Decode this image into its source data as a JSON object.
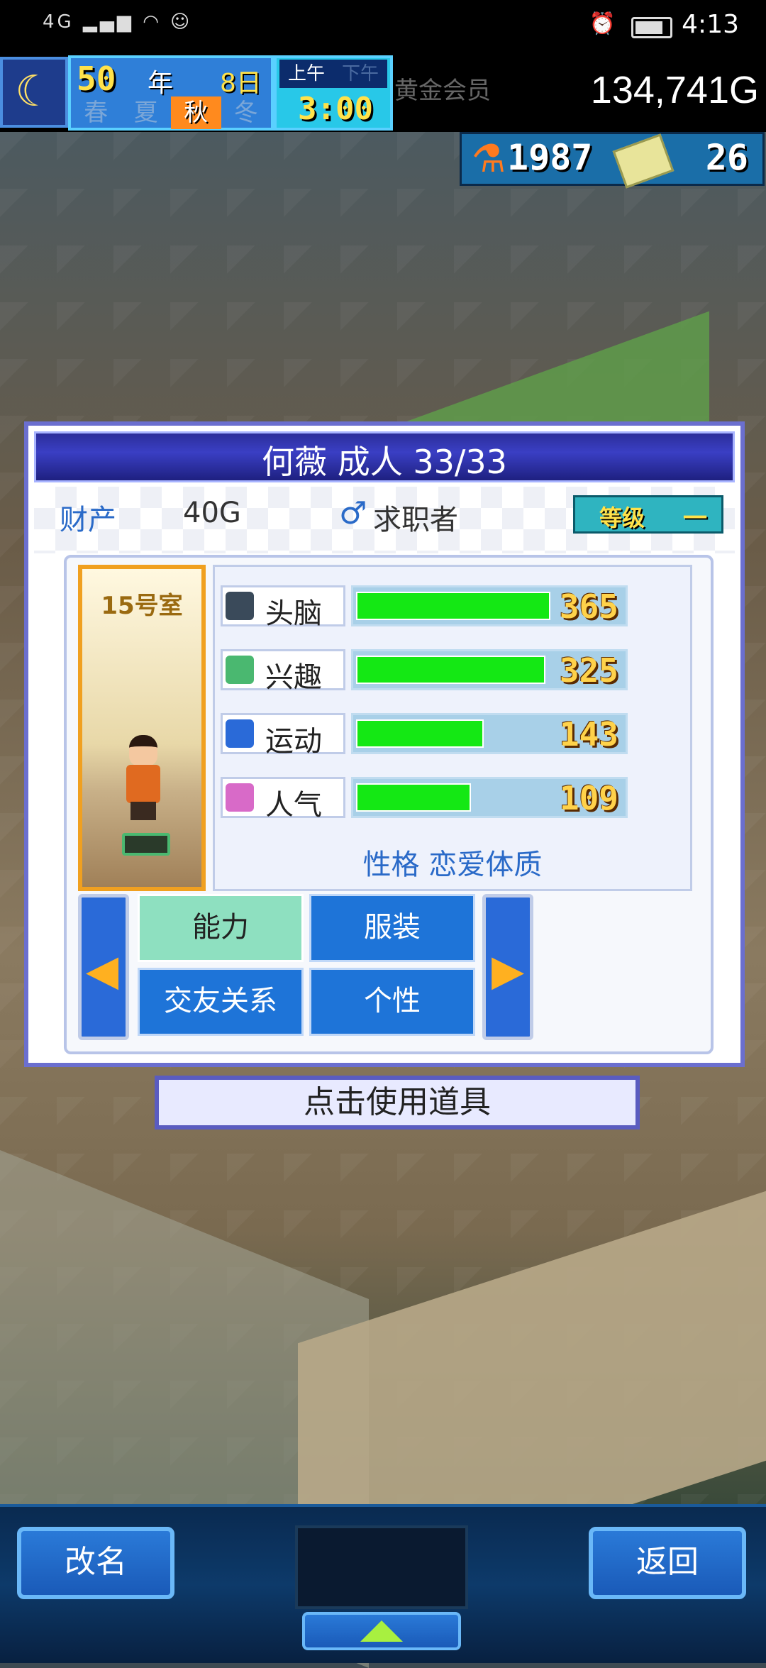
{
  "status_bar": {
    "network": "4G",
    "time": "4:13"
  },
  "hud": {
    "year": "50",
    "year_label": "年",
    "day": "8日",
    "seasons": [
      "春",
      "夏",
      "秋",
      "冬"
    ],
    "active_season": "秋",
    "am_label": "上午",
    "pm_label": "下午",
    "active_period": "上午",
    "clock": "3:00",
    "member": "黄金会员",
    "money": "134,741G",
    "research_points": "1987",
    "tickets": "26"
  },
  "dialog": {
    "title": "何薇 成人 33/33",
    "assets_label": "财产",
    "assets_value": "40G",
    "gender_icon": "male-symbol-icon",
    "job": "求职者",
    "rank_label": "等级",
    "rank_value": "一",
    "room": "15号室",
    "stats": [
      {
        "name": "头脑",
        "value": 365,
        "fill_fraction": 0.73,
        "icon": "brain-monitor-icon",
        "color": "#3a4a5a"
      },
      {
        "name": "兴趣",
        "value": 325,
        "fill_fraction": 0.71,
        "icon": "idea-bubble-icon",
        "color": "#4ab870"
      },
      {
        "name": "运动",
        "value": 143,
        "fill_fraction": 0.48,
        "icon": "running-icon",
        "color": "#2a6ad8"
      },
      {
        "name": "人气",
        "value": 109,
        "fill_fraction": 0.43,
        "icon": "sparkle-icon",
        "color": "#d86ac8"
      }
    ],
    "personality_label": "性格",
    "personality_value": "恋爱体质",
    "tabs": [
      "能力",
      "服装",
      "交友关系",
      "个性"
    ],
    "active_tab": "能力"
  },
  "use_item": "点击使用道具",
  "bottom": {
    "rename": "改名",
    "back": "返回"
  },
  "colors": {
    "stat_fill": "#14e814",
    "tab_blue": "#1e74d8",
    "tab_active": "#8ee0c0",
    "dialog_border": "#6b6fcf"
  }
}
